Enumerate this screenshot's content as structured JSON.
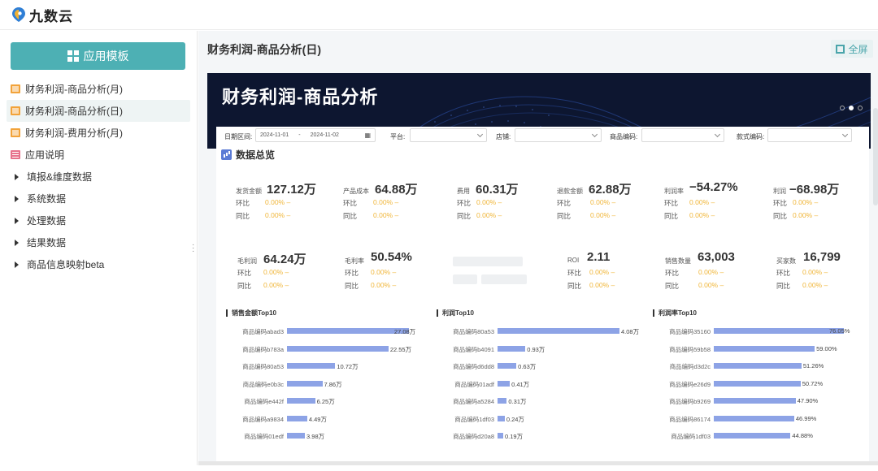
{
  "app": {
    "logo_text": "九数云"
  },
  "sidebar": {
    "template_button": "应用模板",
    "items": [
      {
        "label": "财务利润-商品分析(月)",
        "icon": "report-icon"
      },
      {
        "label": "财务利润-商品分析(日)",
        "icon": "report-icon",
        "active": true
      },
      {
        "label": "财务利润-费用分析(月)",
        "icon": "report-icon"
      },
      {
        "label": "应用说明",
        "icon": "doc-icon"
      },
      {
        "label": "填报&维度数据",
        "icon": "caret-right-icon"
      },
      {
        "label": "系统数据",
        "icon": "caret-right-icon"
      },
      {
        "label": "处理数据",
        "icon": "caret-right-icon"
      },
      {
        "label": "结果数据",
        "icon": "caret-right-icon"
      },
      {
        "label": "商品信息映射beta",
        "icon": "caret-right-icon"
      }
    ]
  },
  "header": {
    "title": "财务利润-商品分析(日)",
    "fullscreen": "全屏"
  },
  "banner": {
    "title": "财务利润-商品分析"
  },
  "filters": {
    "date_label": "日期区间:",
    "date_start": "2024-11-01",
    "date_sep": "-",
    "date_end": "2024-11-02",
    "platform_label": "平台:",
    "shop_label": "店铺:",
    "product_code_label": "商品编码:",
    "style_code_label": "款式编码:"
  },
  "overview": {
    "title": "数据总览",
    "row1": [
      {
        "label": "发货金额",
        "value": "127.12万",
        "mom_label": "环比",
        "mom": "0.00% –",
        "yoy_label": "同比",
        "yoy": "0.00% –"
      },
      {
        "label": "产品成本",
        "value": "64.88万",
        "mom_label": "环比",
        "mom": "0.00% –",
        "yoy_label": "同比",
        "yoy": "0.00% –"
      },
      {
        "label": "费用",
        "value": "60.31万",
        "mom_label": "环比",
        "mom": "0.00% –",
        "yoy_label": "同比",
        "yoy": "0.00% –"
      },
      {
        "label": "退款金额",
        "value": "62.88万",
        "mom_label": "环比",
        "mom": "0.00% –",
        "yoy_label": "同比",
        "yoy": "0.00% –"
      },
      {
        "label": "利润率",
        "value": "−54.27%",
        "mom_label": "环比",
        "mom": "0.00% –",
        "yoy_label": "同比",
        "yoy": "0.00% –"
      },
      {
        "label": "利润",
        "value": "−68.98万",
        "mom_label": "环比",
        "mom": "0.00% –",
        "yoy_label": "同比",
        "yoy": "0.00% –"
      }
    ],
    "row2": [
      {
        "label": "毛利润",
        "value": "64.24万",
        "mom_label": "环比",
        "mom": "0.00% –",
        "yoy_label": "同比",
        "yoy": "0.00% –"
      },
      {
        "label": "毛利率",
        "value": "50.54%",
        "mom_label": "环比",
        "mom": "0.00% –",
        "yoy_label": "同比",
        "yoy": "0.00% –"
      },
      {
        "label": "ROI",
        "value": "2.11",
        "mom_label": "环比",
        "mom": "0.00% –",
        "yoy_label": "同比",
        "yoy": "0.00% –"
      },
      {
        "label": "销售数量",
        "value": "63,003",
        "mom_label": "环比",
        "mom": "0.00% –",
        "yoy_label": "同比",
        "yoy": "0.00% –"
      },
      {
        "label": "买家数",
        "value": "16,799",
        "mom_label": "环比",
        "mom": "0.00% –",
        "yoy_label": "同比",
        "yoy": "0.00% –"
      }
    ]
  },
  "colors": {
    "accent": "#4db0b4",
    "bar": "#8da3e6",
    "pct": "#f0b63a",
    "banner": "#0d1630"
  },
  "chart_data": [
    {
      "type": "bar",
      "title": "销售金额Top10",
      "categories": [
        "商品编码abad3",
        "商品编码b783a",
        "商品编码80a53",
        "商品编码e0b3c",
        "商品编码e442f",
        "商品编码a9834",
        "商品编码01edf"
      ],
      "values": [
        27.08,
        22.55,
        10.72,
        7.86,
        6.25,
        4.49,
        3.98
      ],
      "labels": [
        "27.08万",
        "22.55万",
        "10.72万",
        "7.86万",
        "6.25万",
        "4.49万",
        "3.98万"
      ],
      "xlim": [
        0,
        28
      ]
    },
    {
      "type": "bar",
      "title": "利润Top10",
      "categories": [
        "商品编码80a53",
        "商品编码b4091",
        "商品编码d6dd8",
        "商品编码01adf",
        "商品编码a5284",
        "商品编码1df03",
        "商品编码d20a8"
      ],
      "values": [
        4.08,
        0.93,
        0.63,
        0.41,
        0.31,
        0.24,
        0.19
      ],
      "labels": [
        "4.08万",
        "0.93万",
        "0.63万",
        "0.41万",
        "0.31万",
        "0.24万",
        "0.19万"
      ],
      "xlim": [
        0,
        4.08
      ]
    },
    {
      "type": "bar",
      "title": "利润率Top10",
      "categories": [
        "商品编码35160",
        "商品编码59b58",
        "商品编码d3d2c",
        "商品编码e26d9",
        "商品编码b9269",
        "商品编码86174",
        "商品编码1df03"
      ],
      "values": [
        76.05,
        59.0,
        51.26,
        50.72,
        47.9,
        46.99,
        44.88
      ],
      "labels": [
        "76.05%",
        "59.00%",
        "51.26%",
        "50.72%",
        "47.90%",
        "46.99%",
        "44.88%"
      ],
      "xlim": [
        0,
        76.05
      ]
    }
  ]
}
